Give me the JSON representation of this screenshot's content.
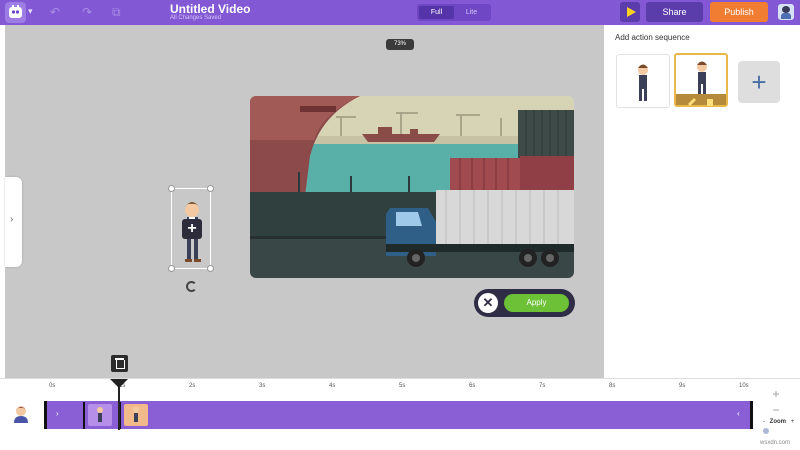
{
  "app": {
    "title": "Untitled Video",
    "saved_status": "All Changes Saved"
  },
  "topbar": {
    "mode_tabs": [
      "Full",
      "Lite"
    ],
    "active_mode": "Full",
    "share_label": "Share",
    "publish_label": "Publish"
  },
  "stage": {
    "zoom_label": "73%",
    "apply_label": "Apply"
  },
  "right_panel": {
    "title": "Add action sequence"
  },
  "timeline": {
    "ticks": [
      "0s",
      "1s",
      "2s",
      "3s",
      "4s",
      "5s",
      "6s",
      "7s",
      "8s",
      "9s",
      "10s"
    ],
    "zoom_label": "Zoom",
    "zoom_minus_symbol": "-",
    "zoom_plus_symbol": "+"
  },
  "watermark": "wsxdn.com",
  "colors": {
    "brand_purple": "#8258d4",
    "publish_orange": "#f07d32",
    "apply_green": "#6cc136",
    "track_purple": "#8a5fd6"
  },
  "icons": {
    "logo": "character-logo-icon",
    "undo": "undo-icon",
    "redo": "redo-icon",
    "play": "play-icon",
    "add": "plus-icon",
    "close": "close-icon",
    "trash": "trash-icon",
    "rotate": "rotate-icon"
  }
}
